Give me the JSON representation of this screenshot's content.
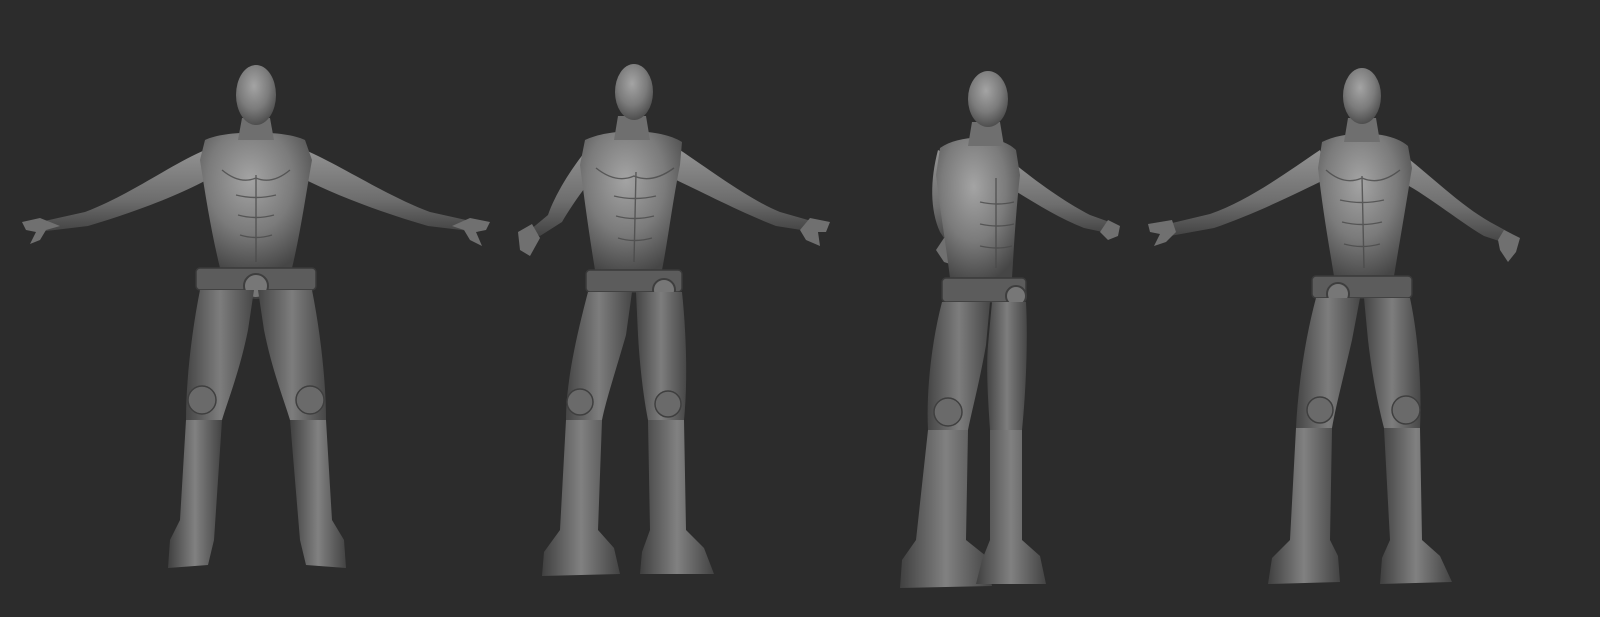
{
  "scene": {
    "background_color": "#2c2c2c",
    "material_base": "#7a7a7a",
    "material_shadow": "#3a3a3a",
    "material_highlight": "#a8a8a8"
  },
  "views": [
    {
      "view": "front"
    },
    {
      "view": "three-quarter-right"
    },
    {
      "view": "side-right"
    },
    {
      "view": "three-quarter-left"
    }
  ]
}
